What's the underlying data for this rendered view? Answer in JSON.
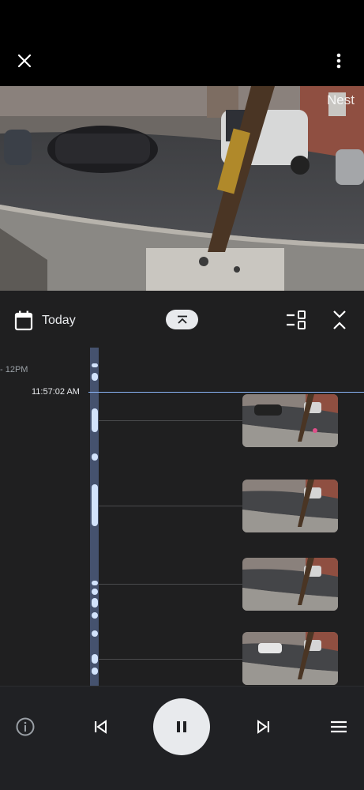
{
  "video": {
    "watermark": "Nest"
  },
  "toolbar": {
    "date_label": "Today"
  },
  "timeline": {
    "hour_label": "- 12PM",
    "current_time": "11:57:02 AM"
  },
  "colors": {
    "background": "#1f1f20",
    "accent_line": "#8ab4f8",
    "event_pill": "#d2e3fc",
    "track": "#45526e"
  },
  "icons": {
    "close": "close-icon",
    "more": "more-vert-icon",
    "calendar": "calendar-icon",
    "collapse": "chevron-up-bar-icon",
    "layout": "view-switch-icon",
    "expand": "unfold-less-icon",
    "info": "info-icon",
    "previous": "skip-previous-icon",
    "pause": "pause-icon",
    "next": "skip-next-icon",
    "menu": "menu-icon"
  }
}
